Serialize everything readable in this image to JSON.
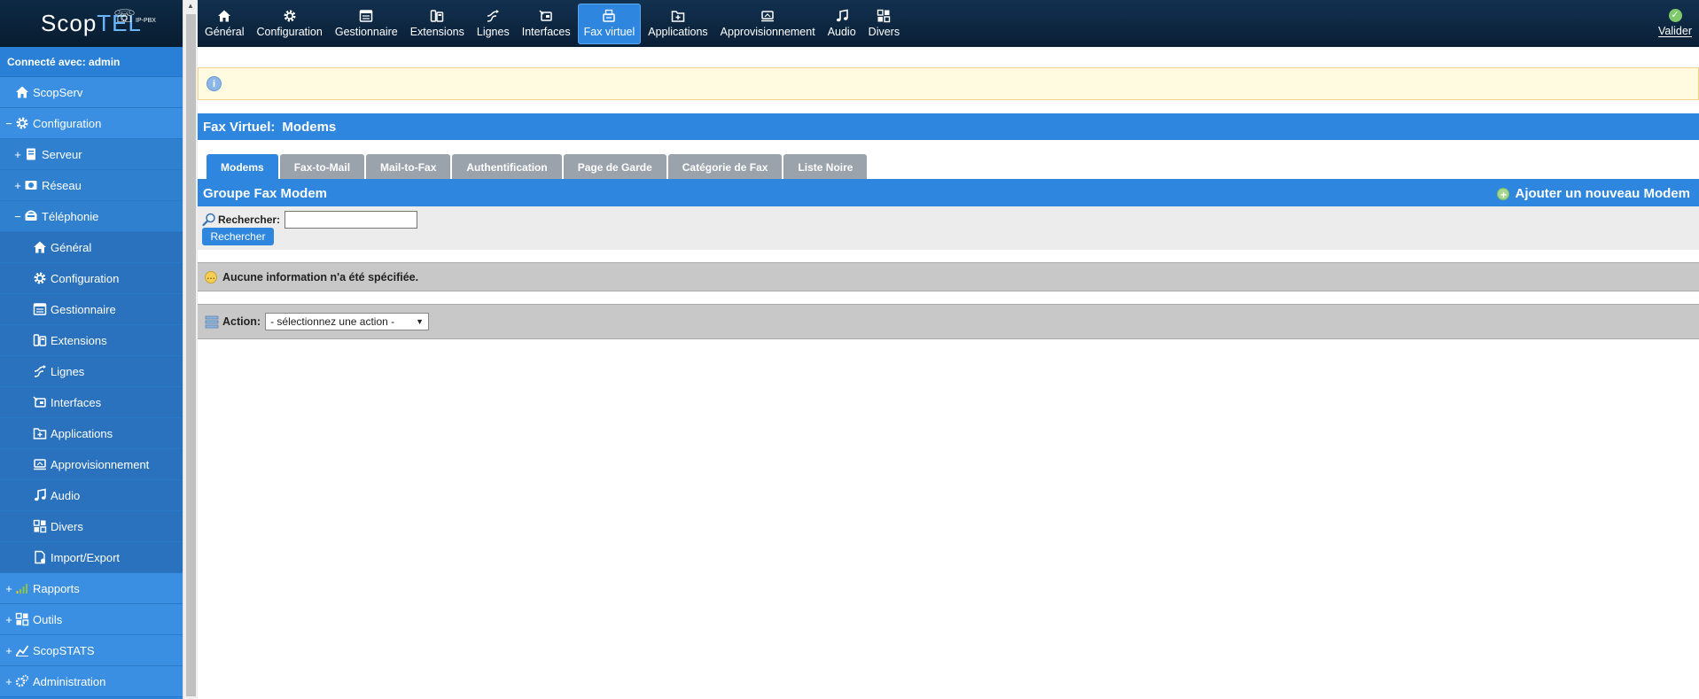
{
  "logo": {
    "text_a": "Scop",
    "text_b": "TEL",
    "badge": "IP-PBX"
  },
  "sidebar": {
    "connected": "Connecté avec: admin",
    "items": [
      {
        "label": "ScopServ",
        "toggle": "",
        "icon": "home-icon"
      },
      {
        "label": "Configuration",
        "toggle": "−",
        "icon": "gear-icon"
      },
      {
        "label": "Serveur",
        "toggle": "+",
        "icon": "server-icon"
      },
      {
        "label": "Réseau",
        "toggle": "+",
        "icon": "network-icon"
      },
      {
        "label": "Téléphonie",
        "toggle": "−",
        "icon": "telephony-icon"
      },
      {
        "label": "Général",
        "icon": "home-icon"
      },
      {
        "label": "Configuration",
        "icon": "gear-icon"
      },
      {
        "label": "Gestionnaire",
        "icon": "manager-icon"
      },
      {
        "label": "Extensions",
        "icon": "extensions-icon"
      },
      {
        "label": "Lignes",
        "icon": "lines-icon"
      },
      {
        "label": "Interfaces",
        "icon": "interfaces-icon"
      },
      {
        "label": "Applications",
        "icon": "applications-icon"
      },
      {
        "label": "Approvisionnement",
        "icon": "provisioning-icon"
      },
      {
        "label": "Audio",
        "icon": "music-icon"
      },
      {
        "label": "Divers",
        "icon": "grid-icon"
      },
      {
        "label": "Import/Export",
        "icon": "document-icon"
      },
      {
        "label": "Rapports",
        "toggle": "+",
        "icon": "chart-bars-icon"
      },
      {
        "label": "Outils",
        "toggle": "+",
        "icon": "grid-icon"
      },
      {
        "label": "ScopSTATS",
        "toggle": "+",
        "icon": "chart-line-icon"
      },
      {
        "label": "Administration",
        "toggle": "+",
        "icon": "gears-icon"
      }
    ]
  },
  "toolbar": {
    "items": [
      {
        "label": "Général",
        "icon": "home-icon"
      },
      {
        "label": "Configuration",
        "icon": "gear-icon"
      },
      {
        "label": "Gestionnaire",
        "icon": "manager-icon"
      },
      {
        "label": "Extensions",
        "icon": "extensions-icon"
      },
      {
        "label": "Lignes",
        "icon": "lines-icon"
      },
      {
        "label": "Interfaces",
        "icon": "interfaces-icon"
      },
      {
        "label": "Fax virtuel",
        "icon": "fax-icon"
      },
      {
        "label": "Applications",
        "icon": "applications-icon"
      },
      {
        "label": "Approvisionnement",
        "icon": "provisioning-icon"
      },
      {
        "label": "Audio",
        "icon": "music-icon"
      },
      {
        "label": "Divers",
        "icon": "grid-icon"
      }
    ],
    "active": "Fax virtuel",
    "valider": "Valider"
  },
  "main": {
    "info_icon": "i",
    "title": "Fax Virtuel:",
    "subtitle": "Modems",
    "tabs": [
      "Modems",
      "Fax-to-Mail",
      "Mail-to-Fax",
      "Authentification",
      "Page de Garde",
      "Catégorie de Fax",
      "Liste Noire"
    ],
    "active_tab": "Modems",
    "group_title": "Groupe Fax Modem",
    "add_label": "Ajouter un nouveau Modem",
    "search_label": "Rechercher:",
    "search_value": "",
    "search_button": "Rechercher",
    "empty_message": "Aucune information n'a été spécifiée.",
    "action_label": "Action:",
    "action_selected": "- sélectionnez une action -"
  },
  "colors": {
    "accent": "#2e86de",
    "topbar": "#0d2a45",
    "info_bg": "#fffbe0",
    "tab_inactive": "#9aa3ab",
    "panel_gray": "#c8c8c8"
  }
}
